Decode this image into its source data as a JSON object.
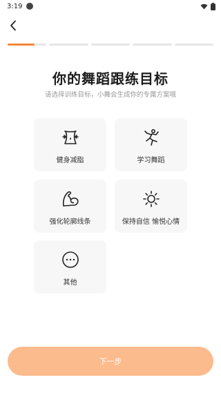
{
  "status_bar": {
    "time": "3:19"
  },
  "progress": {
    "total_steps": 5,
    "current_step": 1
  },
  "header": {
    "title": "你的舞蹈跟练目标",
    "subtitle": "请选择训练目标，小舞会生成你的专属方案哦"
  },
  "goals": [
    {
      "label": "健身减脂",
      "icon": "waist-slimming-icon"
    },
    {
      "label": "学习舞蹈",
      "icon": "dancer-icon"
    },
    {
      "label": "强化轮廓线条",
      "icon": "flexed-bicep-icon"
    },
    {
      "label": "保持自信 愉悦心情",
      "icon": "sun-icon"
    },
    {
      "label": "其他",
      "icon": "more-dots-icon"
    }
  ],
  "next_button": {
    "label": "下一步"
  },
  "colors": {
    "accent": "#f5863a",
    "button": "#fcbb8c",
    "card_bg": "#f7f7f7",
    "track": "#e6e6e6"
  }
}
